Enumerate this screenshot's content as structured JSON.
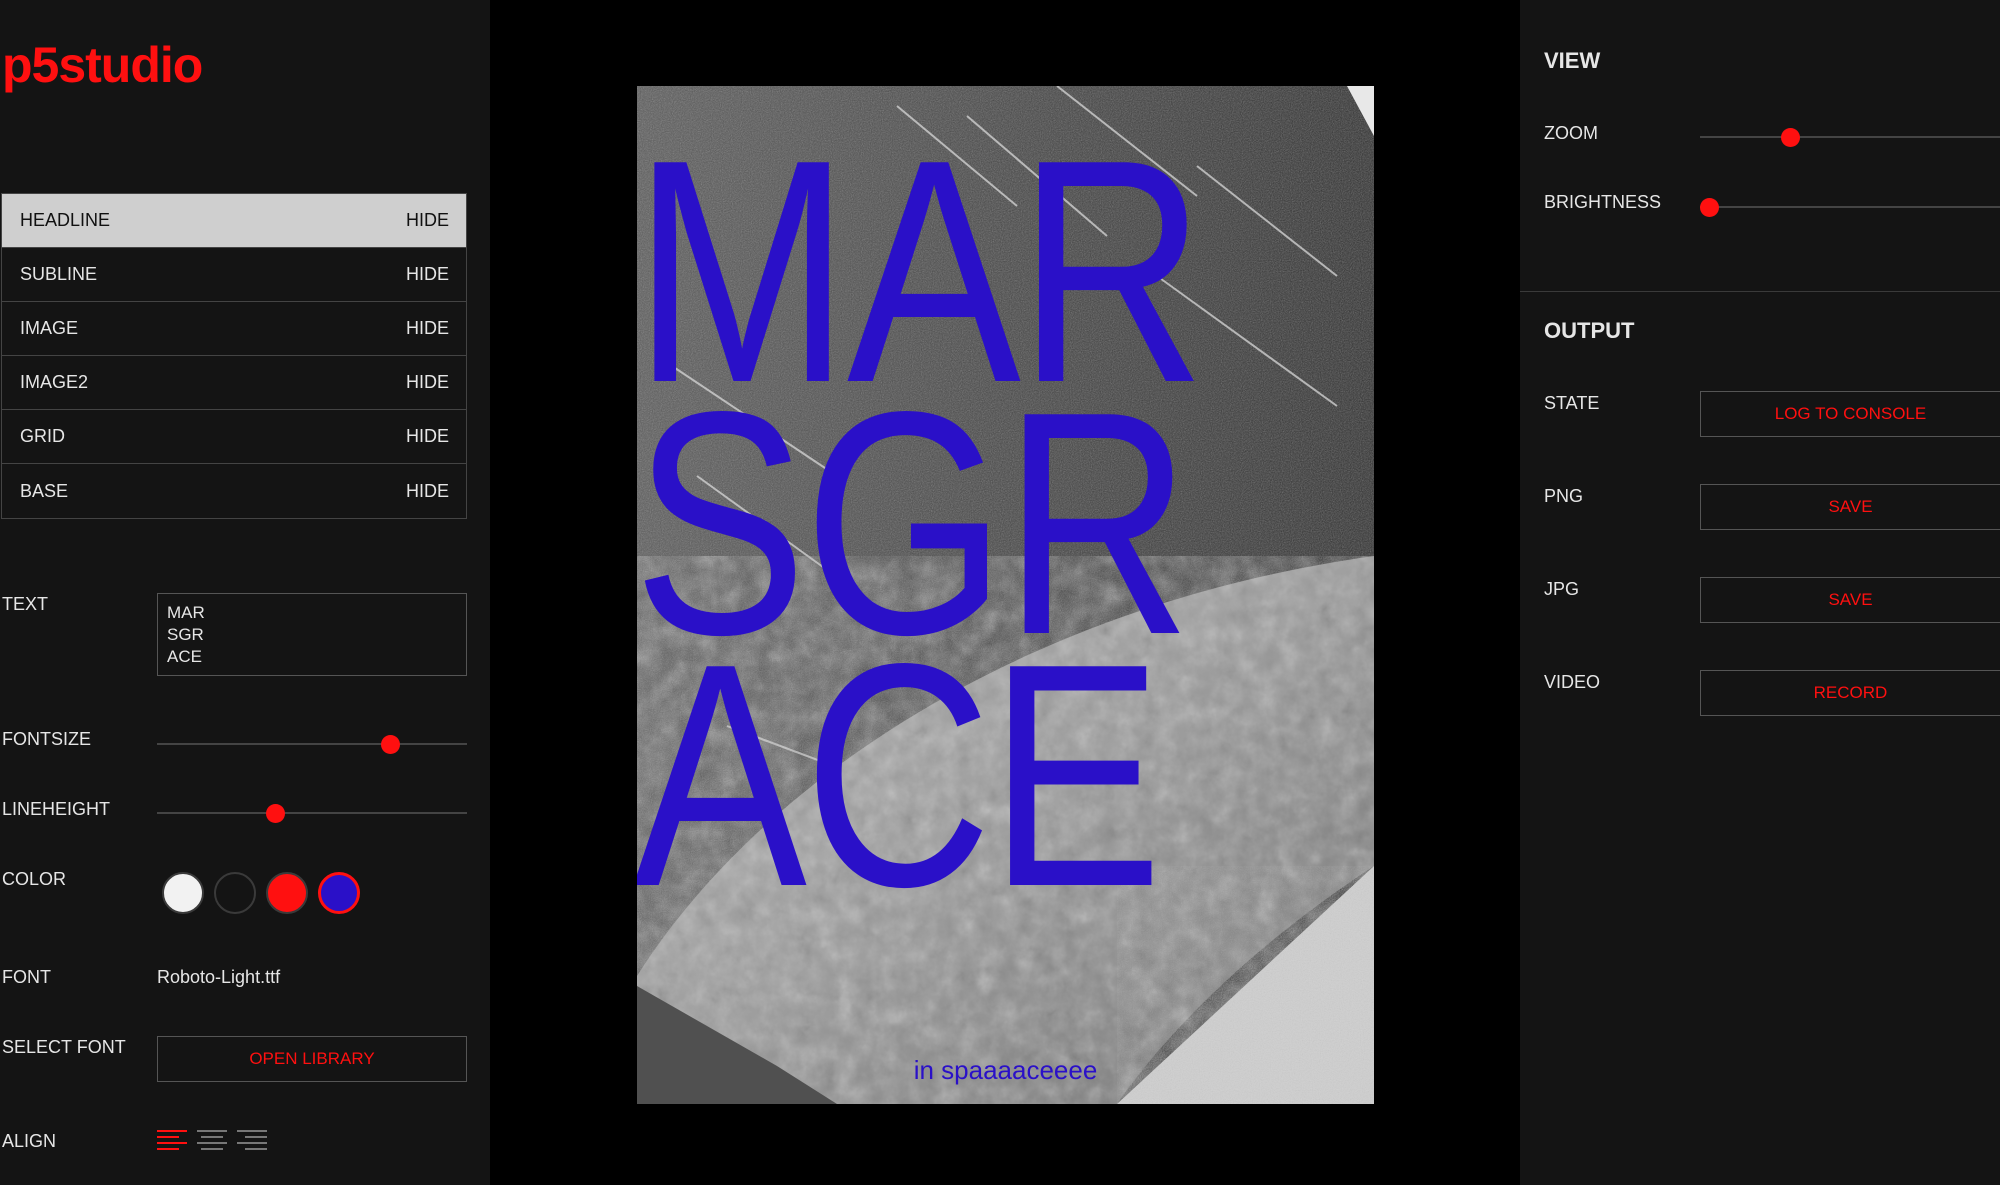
{
  "app": {
    "logo": "p5studio"
  },
  "layers": [
    {
      "label": "HEADLINE",
      "action": "HIDE",
      "active": true
    },
    {
      "label": "SUBLINE",
      "action": "HIDE",
      "active": false
    },
    {
      "label": "IMAGE",
      "action": "HIDE",
      "active": false
    },
    {
      "label": "IMAGE2",
      "action": "HIDE",
      "active": false
    },
    {
      "label": "GRID",
      "action": "HIDE",
      "active": false
    },
    {
      "label": "BASE",
      "action": "HIDE",
      "active": false
    }
  ],
  "properties": {
    "text_label": "TEXT",
    "text_value": "MAR\nSGR\nACE",
    "fontsize_label": "FONTSIZE",
    "fontsize_value": 0.75,
    "lineheight_label": "LINEHEIGHT",
    "lineheight_value": 0.38,
    "color_label": "COLOR",
    "colors": [
      {
        "name": "white",
        "hex": "#f2f2f2",
        "selected": false
      },
      {
        "name": "black",
        "hex": "#141414",
        "selected": false
      },
      {
        "name": "red",
        "hex": "#ff1010",
        "selected": false
      },
      {
        "name": "blue",
        "hex": "#2a10c8",
        "selected": true
      }
    ],
    "font_label": "FONT",
    "font_value": "Roboto-Light.ttf",
    "select_font_label": "SELECT FONT",
    "open_library_label": "OPEN LIBRARY",
    "align_label": "ALIGN",
    "align_options": [
      "left",
      "center",
      "right"
    ],
    "align_selected": "left"
  },
  "poster": {
    "headline": "MAR\nSGR\nACE",
    "subline": "in spaaaaceeee",
    "text_color": "#2a10c8"
  },
  "view": {
    "title": "VIEW",
    "zoom_label": "ZOOM",
    "zoom_value": 0.3,
    "brightness_label": "BRIGHTNESS",
    "brightness_value": 0.03
  },
  "output": {
    "title": "OUTPUT",
    "state_label": "STATE",
    "state_button": "LOG TO CONSOLE",
    "png_label": "PNG",
    "png_button": "SAVE",
    "jpg_label": "JPG",
    "jpg_button": "SAVE",
    "video_label": "VIDEO",
    "video_button": "RECORD"
  },
  "theme": {
    "accent": "#ff1010",
    "panel_bg": "#141414",
    "canvas_bg": "#000000"
  }
}
